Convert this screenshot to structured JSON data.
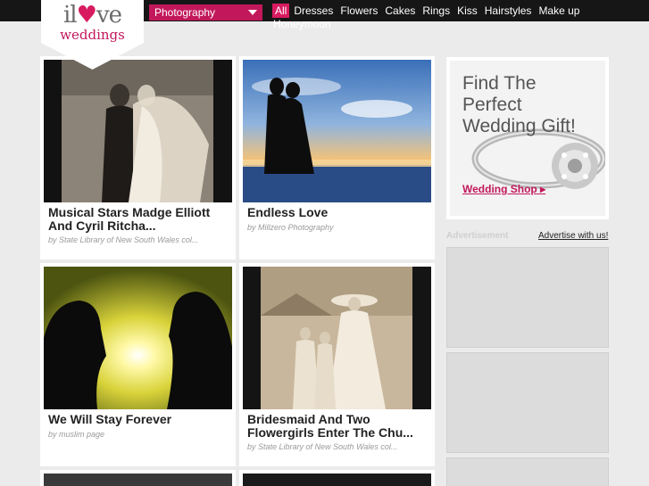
{
  "logo": {
    "line1_pre": "il",
    "line1_heart": "♥",
    "line1_post": "ve",
    "line2": "weddings"
  },
  "category_select": {
    "value": "Photography"
  },
  "nav": {
    "items": [
      "All",
      "Dresses",
      "Flowers",
      "Cakes",
      "Rings",
      "Kiss",
      "Hairstyles",
      "Make up"
    ],
    "wrap_item": "Honeymoon"
  },
  "cards": [
    {
      "title": "Musical Stars Madge Elliott And Cyril Ritcha...",
      "by": "by State Library of New South Wales col..."
    },
    {
      "title": "Endless Love",
      "by": "by Millzero Photography"
    },
    {
      "title": "We Will Stay Forever",
      "by": "by muslim page"
    },
    {
      "title": "Bridesmaid And Two Flowergirls Enter The Chu...",
      "by": "by State Library of New South Wales col..."
    }
  ],
  "gift_ad": {
    "headline": "Find The Perfect Wedding Gift!",
    "link": "Wedding Shop"
  },
  "sidebar": {
    "ad_label": "Advertisement",
    "advertise_link": "Advertise with us!"
  },
  "colors": {
    "brand_pink": "#c2185b",
    "nav_active": "#d81b60",
    "topbar": "#161616"
  }
}
